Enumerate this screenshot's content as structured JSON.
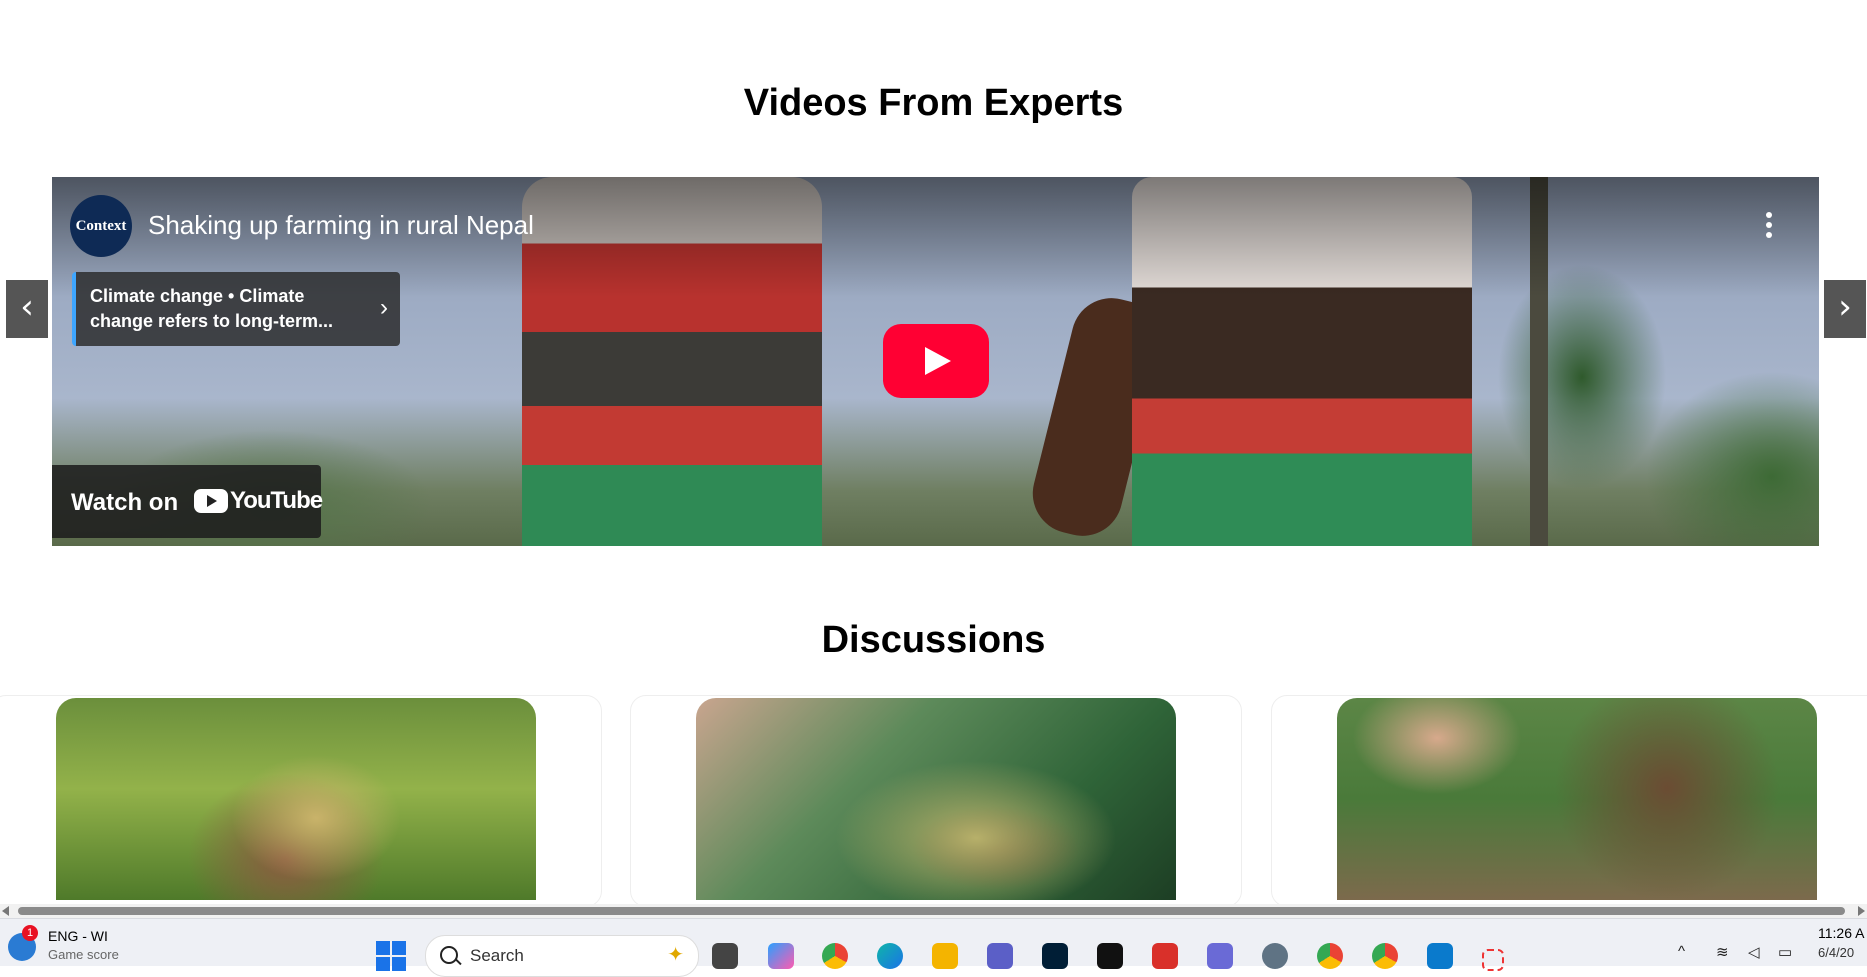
{
  "videos_section": {
    "title": "Videos From Experts",
    "video": {
      "channel_logo_text": "Context",
      "title": "Shaking up farming in rural Nepal",
      "info_card": "Climate change • Climate change refers to long-term...",
      "watch_on_label": "Watch on",
      "youtube_wordmark": "YouTube"
    },
    "prev_arrow": "‹",
    "next_arrow": "›"
  },
  "discussions_section": {
    "title": "Discussions",
    "cards": [
      {
        "image": "hands-holding-grain-photo"
      },
      {
        "image": "diseased-leaf-photo"
      },
      {
        "image": "wilted-plant-photo"
      }
    ]
  },
  "taskbar": {
    "notification_count": "1",
    "language": "ENG - WI",
    "widget_subtext": "Game score",
    "search_placeholder": "Search",
    "clock": "11:26 A",
    "date": "6/4/20"
  },
  "colors": {
    "youtube_red": "#ff0033",
    "info_card_accent": "#3ea6ff",
    "nav_arrow_bg": "#555555"
  }
}
